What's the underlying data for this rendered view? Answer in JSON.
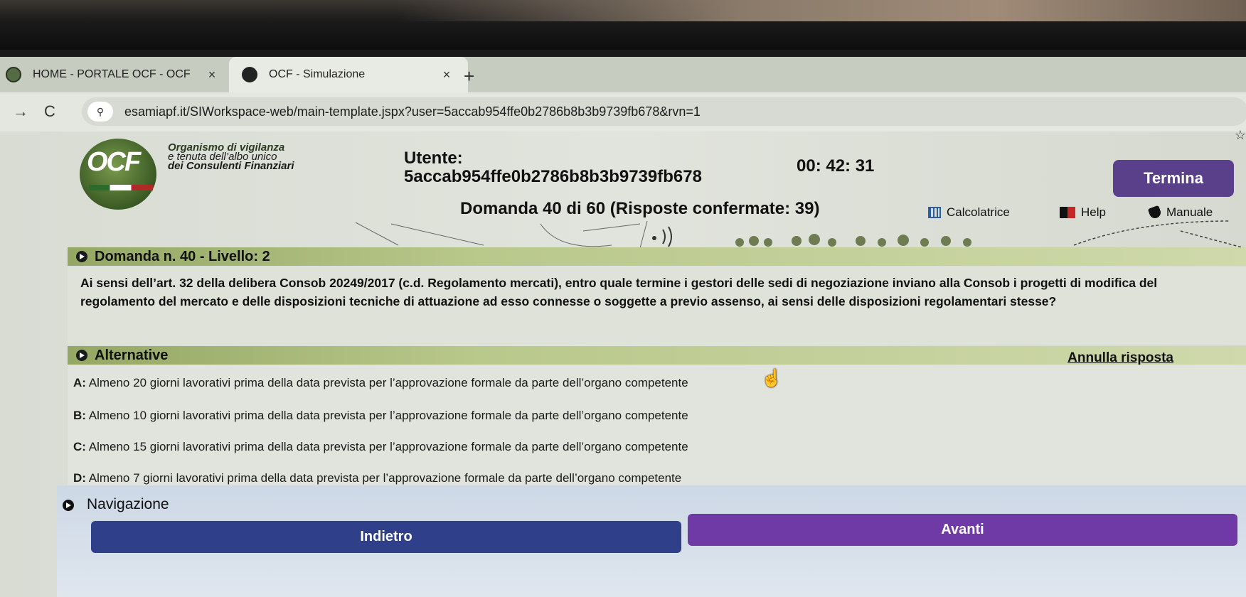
{
  "browser": {
    "tabs": [
      {
        "title": "HOME - PORTALE OCF - OCF",
        "close": "×"
      },
      {
        "title": "OCF - Simulazione",
        "close": "×"
      }
    ],
    "new_tab": "+",
    "back": "→",
    "reload": "C",
    "url": "esamiapf.it/SIWorkspace-web/main-template.jspx?user=5accab954ffe0b2786b8b3b9739fb678&rvn=1"
  },
  "header": {
    "logo_text": "OCF",
    "org_line1": "Organismo di vigilanza",
    "org_line2": "e tenuta dell’albo unico",
    "org_line3": "dei Consulenti Finanziari",
    "user_label": "Utente:",
    "user_id": "5accab954ffe0b2786b8b3b9739fb678",
    "timer": "00: 42: 31",
    "termina": "Termina",
    "question_counter": "Domanda 40 di 60 (Risposte confermate: 39)",
    "tools": {
      "calc": "Calcolatrice",
      "help": "Help",
      "manual": "Manuale"
    }
  },
  "question": {
    "section_title": "Domanda n. 40 - Livello: 2",
    "text": "Ai sensi dell’art. 32 della delibera Consob 20249/2017 (c.d. Regolamento mercati), entro quale termine i gestori delle sedi di negoziazione inviano alla Consob i progetti di modifica del regolamento del mercato e delle disposizioni tecniche di attuazione ad esso connesse o soggette a previo assenso, ai sensi delle disposizioni regolamentari stesse?"
  },
  "alternatives": {
    "section_title": "Alternative",
    "annulla": "Annulla risposta",
    "items": [
      {
        "letter": "A:",
        "text": "Almeno 20 giorni lavorativi prima della data prevista per l’approvazione formale da parte dell’organo competente"
      },
      {
        "letter": "B:",
        "text": "Almeno 10 giorni lavorativi prima della data prevista per l’approvazione formale da parte dell’organo competente"
      },
      {
        "letter": "C:",
        "text": "Almeno 15 giorni lavorativi prima della data prevista per l’approvazione formale da parte dell’organo competente"
      },
      {
        "letter": "D:",
        "text": "Almeno 7 giorni lavorativi prima della data prevista per l’approvazione formale da parte dell’organo competente"
      }
    ]
  },
  "navigation": {
    "section_title": "Navigazione",
    "back": "Indietro",
    "next": "Avanti"
  },
  "colors": {
    "termina": "#5a3f8a",
    "back_button": "#2f3f8a",
    "next_button": "#6f3aa5",
    "section_bar": "#b9c88b"
  }
}
